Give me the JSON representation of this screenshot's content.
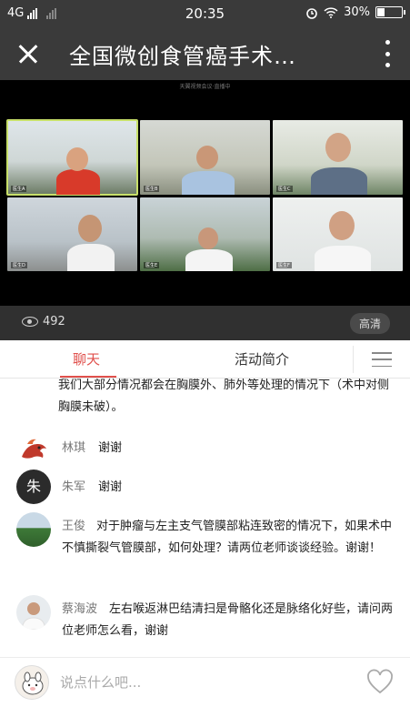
{
  "status": {
    "network": "4G",
    "time": "20:35",
    "battery": "30%",
    "battery_level": 0.3
  },
  "nav": {
    "title": "全国微创食管癌手术…"
  },
  "video": {
    "caption": "天翼视频会议·直播中",
    "tiles": [
      {
        "plate": "医生A"
      },
      {
        "plate": "医生B"
      },
      {
        "plate": "医生C"
      },
      {
        "plate": "医生D"
      },
      {
        "plate": "医生E"
      },
      {
        "plate": "医生F"
      }
    ],
    "views": "492",
    "quality": "高清"
  },
  "tabs": {
    "chat": "聊天",
    "intro": "活动简介"
  },
  "chat": {
    "partial": "我们大部分情况都会在胸膜外、肺外等处理的情况下（术中对侧胸膜未破）。",
    "messages": [
      {
        "name": "林琪",
        "text": "谢谢",
        "avatar": "dragon-avatar"
      },
      {
        "name": "朱军",
        "text": "谢谢",
        "avatar_text": "朱"
      },
      {
        "name": "王俊",
        "text": "对于肿瘤与左主支气管膜部粘连致密的情况下，如果术中不慎撕裂气管膜部，如何处理？请两位老师谈谈经验。谢谢！",
        "avatar": "field-avatar"
      },
      {
        "name": "蔡海波",
        "text": "左右喉返淋巴结清扫是骨骼化还是脉络化好些，请问两位老师怎么看，谢谢",
        "avatar": "doctor-avatar"
      }
    ]
  },
  "input": {
    "placeholder": "说点什么吧..."
  }
}
